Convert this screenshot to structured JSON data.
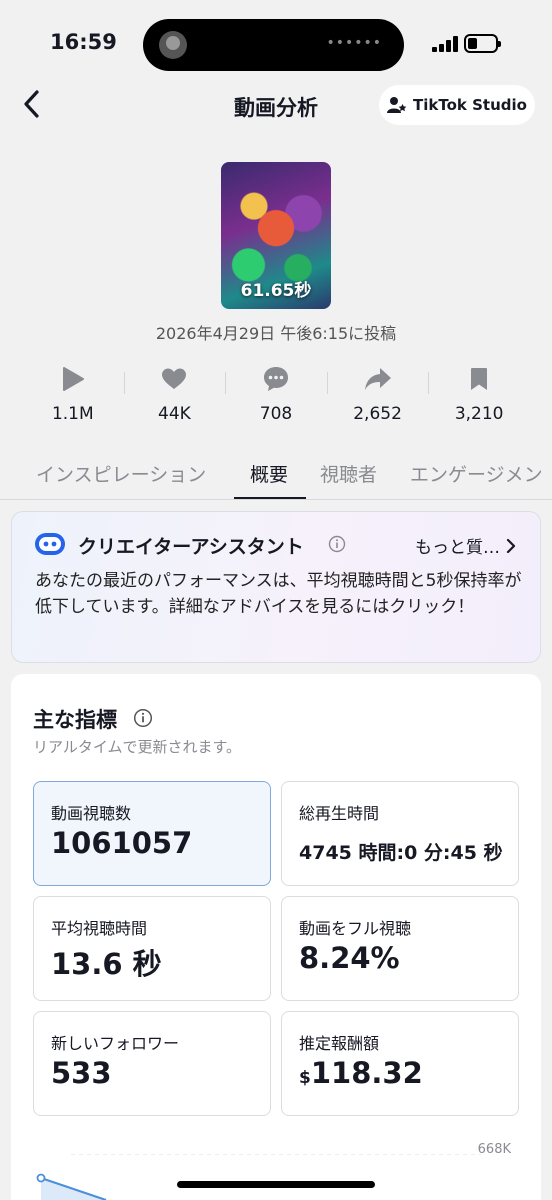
{
  "status": {
    "time": "16:59"
  },
  "nav": {
    "title": "動画分析",
    "studio_label": "TikTok Studio"
  },
  "video": {
    "duration": "61.65秒",
    "posted": "2026年4月29日 午後6:15に投稿"
  },
  "stats": [
    {
      "icon": "play-icon",
      "value": "1.1M"
    },
    {
      "icon": "heart-icon",
      "value": "44K"
    },
    {
      "icon": "comment-icon",
      "value": "708"
    },
    {
      "icon": "share-icon",
      "value": "2,652"
    },
    {
      "icon": "bookmark-icon",
      "value": "3,210"
    }
  ],
  "tabs": [
    "インスピレーション",
    "概要",
    "視聴者",
    "エンゲージメン"
  ],
  "active_tab": "概要",
  "assistant": {
    "title": "クリエイターアシスタント",
    "more": "もっと質…",
    "text": "あなたの最近のパフォーマンスは、平均視聴時間と5秒保持率が低下しています。詳細なアドバイスを見るにはクリック！"
  },
  "metrics": {
    "title": "主な指標",
    "subtitle": "リアルタイムで更新されます。",
    "items": [
      {
        "label": "動画視聴数",
        "value": "1061057"
      },
      {
        "label": "総再生時間",
        "value": "4745 時間:0 分:45 秒"
      },
      {
        "label": "平均視聴時間",
        "value": "13.6 秒"
      },
      {
        "label": "動画をフル視聴",
        "value": "8.24%"
      },
      {
        "label": "新しいフォロワー",
        "value": "533"
      },
      {
        "label": "推定報酬額",
        "currency": "$",
        "value": "118.32"
      }
    ],
    "chart_max_label": "668K"
  },
  "colors": {
    "accent": "#161823",
    "selected_border": "#7fa9d8",
    "chart_line": "#4a90d9"
  }
}
